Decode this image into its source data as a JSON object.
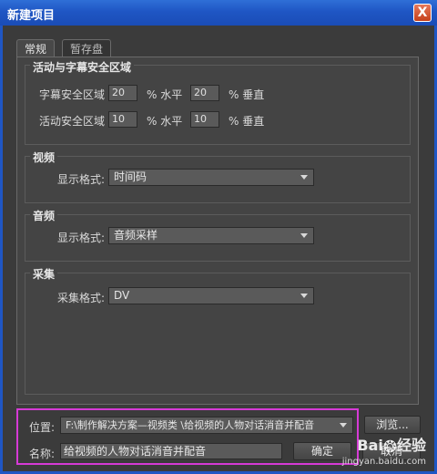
{
  "window": {
    "title": "新建项目",
    "close_label": "X"
  },
  "tabs": [
    {
      "label": "常规",
      "active": true
    },
    {
      "label": "暂存盘",
      "active": false
    }
  ],
  "safe_area": {
    "title": "活动与字幕安全区域",
    "title_safe_label": "字幕安全区域",
    "title_safe_h": "20",
    "title_safe_v": "20",
    "action_safe_label": "活动安全区域",
    "action_safe_h": "10",
    "action_safe_v": "10",
    "pct_horizontal": "% 水平",
    "pct_vertical": "% 垂直"
  },
  "video": {
    "title": "视频",
    "label": "显示格式:",
    "value": "时间码"
  },
  "audio": {
    "title": "音频",
    "label": "显示格式:",
    "value": "音频采样"
  },
  "capture": {
    "title": "采集",
    "label": "采集格式:",
    "value": "DV"
  },
  "location": {
    "label": "位置:",
    "value": "F:\\制作解决方案—视频类 \\给视频的人物对话消音并配音",
    "browse_label": "浏览..."
  },
  "name": {
    "label": "名称:",
    "value": "给视频的人物对话消音并配音"
  },
  "buttons": {
    "ok": "确定",
    "cancel": "取消"
  },
  "watermark": {
    "brand": "Bai",
    "brand_cn": "经验",
    "url": "jingyan.baidu.com"
  },
  "colors": {
    "title_bar": "#1f56c4",
    "highlight": "#d63ad6",
    "dialog_bg": "#3b3b3b"
  }
}
